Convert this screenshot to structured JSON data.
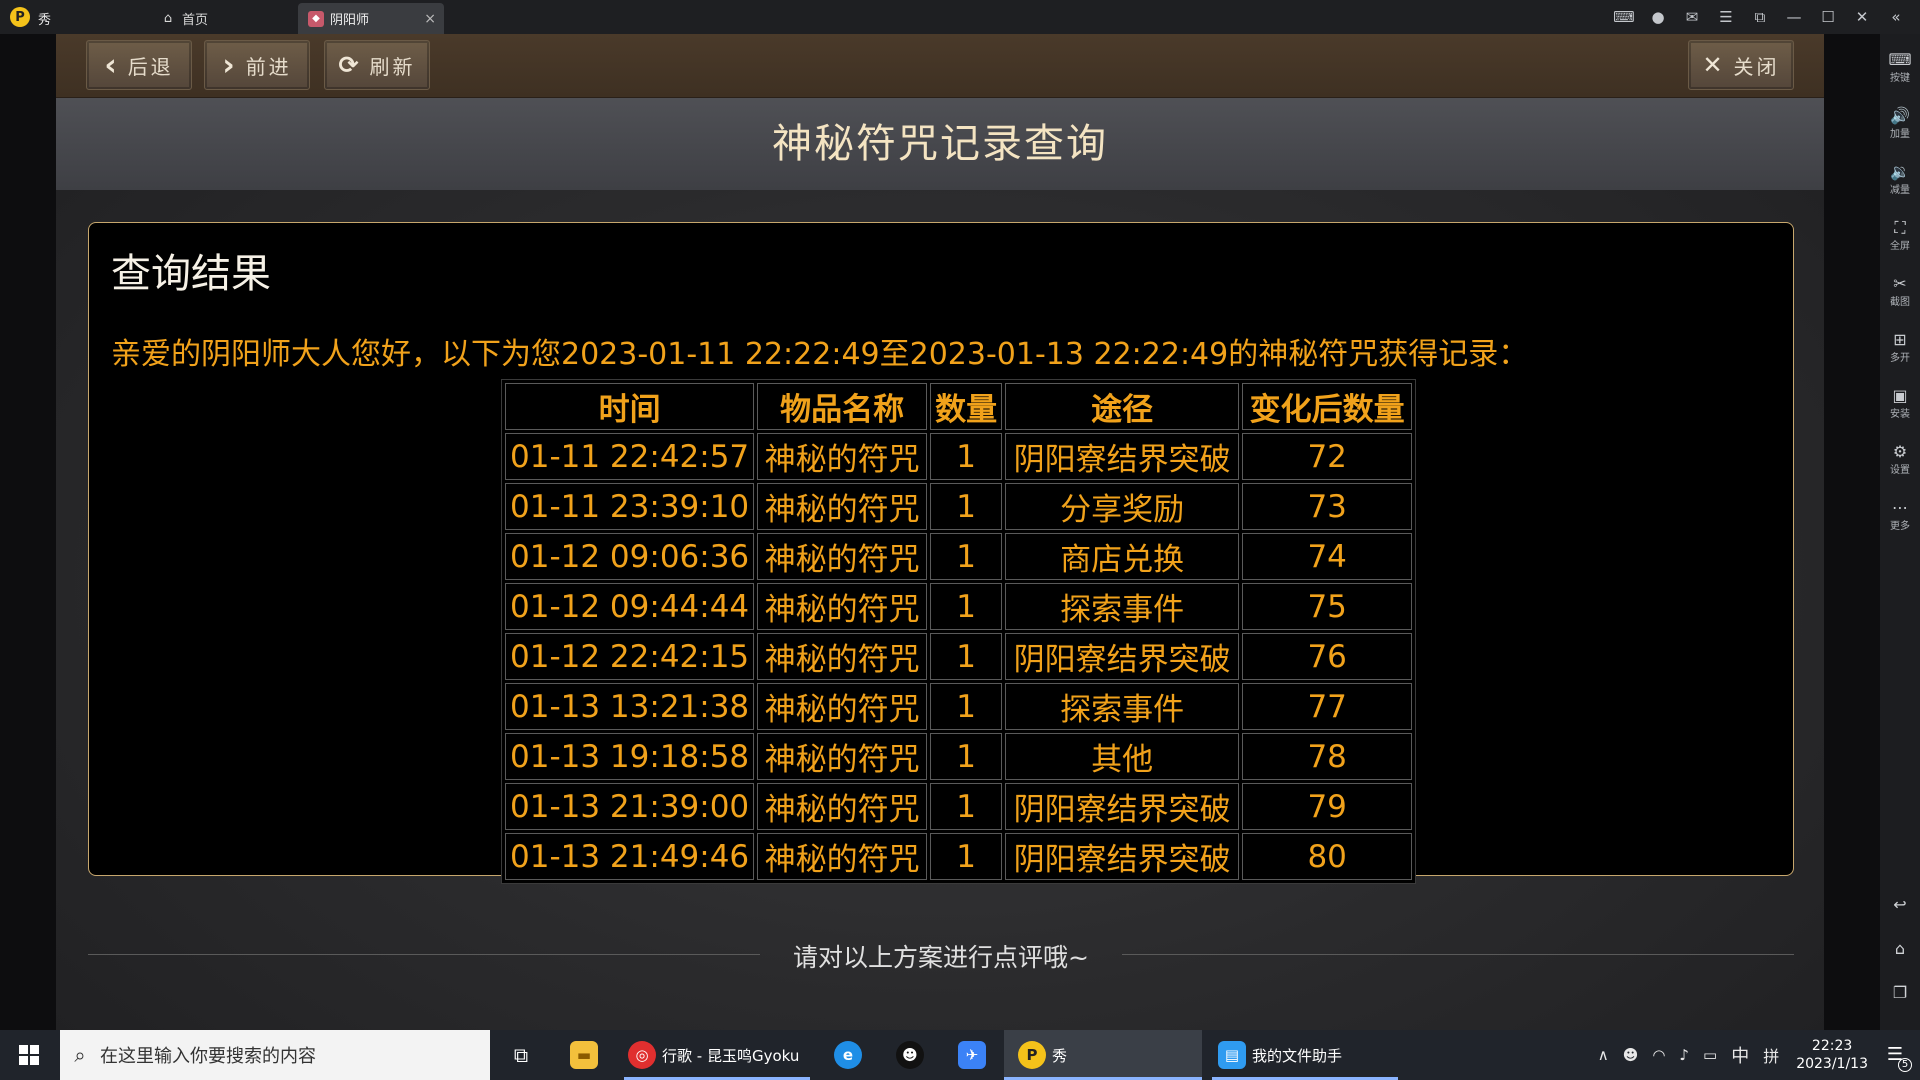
{
  "titlebar": {
    "app_name": "秀",
    "logo_glyph": "P",
    "tabs": [
      {
        "label": "首页",
        "icon": "home-icon"
      },
      {
        "label": "阴阳师",
        "icon": "game-icon",
        "close": "×"
      }
    ],
    "icons": [
      "gamepad-icon",
      "user-icon",
      "mail-icon",
      "menu-icon",
      "restore-tab-icon",
      "minimize-icon",
      "maximize-icon",
      "close-icon",
      "collapse-icon"
    ]
  },
  "right_toolbar": {
    "items": [
      {
        "label": "按键",
        "icon": "keyboard-icon"
      },
      {
        "label": "加量",
        "icon": "volume-up-icon"
      },
      {
        "label": "减量",
        "icon": "volume-down-icon"
      },
      {
        "label": "全屏",
        "icon": "fullscreen-icon"
      },
      {
        "label": "截图",
        "icon": "scissors-icon"
      },
      {
        "label": "多开",
        "icon": "multi-instance-icon"
      },
      {
        "label": "安装",
        "icon": "apk-install-icon"
      },
      {
        "label": "设置",
        "icon": "settings-icon"
      },
      {
        "label": "更多",
        "icon": "more-icon"
      }
    ],
    "bottom_icons": [
      "back-icon",
      "home-icon",
      "recent-apps-icon"
    ]
  },
  "navbar": {
    "back": "后退",
    "forward": "前进",
    "refresh": "刷新",
    "close": "关闭"
  },
  "page": {
    "title": "神秘符咒记录查询",
    "result_heading": "查询结果",
    "intro": "亲爱的阴阳师大人您好，以下为您2023-01-11 22:22:49至2023-01-13 22:22:49的神秘符咒获得记录：",
    "table": {
      "headers": [
        "时间",
        "物品名称",
        "数量",
        "途径",
        "变化后数量"
      ],
      "rows": [
        [
          "01-11 22:42:57",
          "神秘的符咒",
          "1",
          "阴阳寮结界突破",
          "72"
        ],
        [
          "01-11 23:39:10",
          "神秘的符咒",
          "1",
          "分享奖励",
          "73"
        ],
        [
          "01-12 09:06:36",
          "神秘的符咒",
          "1",
          "商店兑换",
          "74"
        ],
        [
          "01-12 09:44:44",
          "神秘的符咒",
          "1",
          "探索事件",
          "75"
        ],
        [
          "01-12 22:42:15",
          "神秘的符咒",
          "1",
          "阴阳寮结界突破",
          "76"
        ],
        [
          "01-13 13:21:38",
          "神秘的符咒",
          "1",
          "探索事件",
          "77"
        ],
        [
          "01-13 19:18:58",
          "神秘的符咒",
          "1",
          "其他",
          "78"
        ],
        [
          "01-13 21:39:00",
          "神秘的符咒",
          "1",
          "阴阳寮结界突破",
          "79"
        ],
        [
          "01-13 21:49:46",
          "神秘的符咒",
          "1",
          "阴阳寮结界突破",
          "80"
        ]
      ]
    },
    "rating_prompt": "请对以上方案进行点评哦~"
  },
  "taskbar": {
    "search_placeholder": "在这里输入你要搜索的内容",
    "apps": [
      {
        "label": "",
        "icon": "task-view-icon"
      },
      {
        "label": "",
        "icon": "file-explorer-icon"
      },
      {
        "label": "行歌 - 昆玉鸣Gyoku",
        "icon": "netease-music-icon"
      },
      {
        "label": "",
        "icon": "edge-icon"
      },
      {
        "label": "",
        "icon": "qq-icon"
      },
      {
        "label": "",
        "icon": "feishu-icon"
      },
      {
        "label": "秀",
        "icon": "emulator-icon"
      },
      {
        "label": "我的文件助手",
        "icon": "file-assistant-icon"
      }
    ],
    "tray": {
      "ime": "中",
      "layout_glyph": "拼",
      "time": "22:23",
      "date": "2023/1/13",
      "notifications": "5"
    }
  },
  "colors": {
    "accent_orange": "#f1a21b",
    "title_cream": "#f4e4c2",
    "box_border": "#c7a76d"
  }
}
